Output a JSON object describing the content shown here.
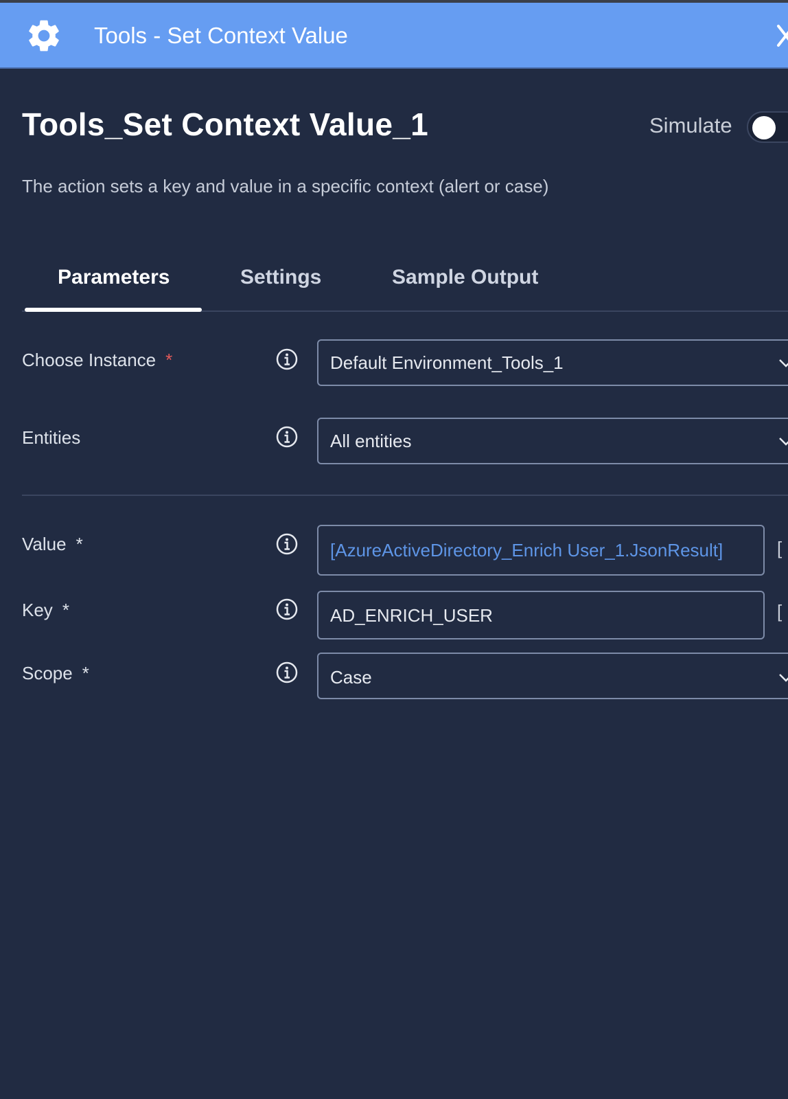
{
  "window": {
    "title": "Tools - Set Context Value",
    "icon": "gear-icon",
    "close_icon": "close-icon"
  },
  "action": {
    "name": "Tools_Set Context Value_1",
    "description": "The action sets a key and value in a specific context (alert or case)"
  },
  "simulate": {
    "label": "Simulate",
    "enabled": false
  },
  "tabs": [
    {
      "label": "Parameters",
      "active": true
    },
    {
      "label": "Settings",
      "active": false
    },
    {
      "label": "Sample Output",
      "active": false
    }
  ],
  "fields": {
    "instance": {
      "label": "Choose Instance",
      "required_mark": "*",
      "value": "Default Environment_Tools_1"
    },
    "entities": {
      "label": "Entities",
      "value": "All entities"
    },
    "value": {
      "label": "Value",
      "required_mark": "*",
      "value": "[AzureActiveDirectory_Enrich User_1.JsonResult]",
      "side_glyph": "["
    },
    "key": {
      "label": "Key",
      "required_mark": "*",
      "value": "AD_ENRICH_USER",
      "side_glyph": "["
    },
    "scope": {
      "label": "Scope",
      "required_mark": "*",
      "value": "Case"
    }
  },
  "colors": {
    "header_bg": "#669df2",
    "panel_bg": "#212b42",
    "link_text": "#5e95e6",
    "required_red": "#e35a5a"
  }
}
